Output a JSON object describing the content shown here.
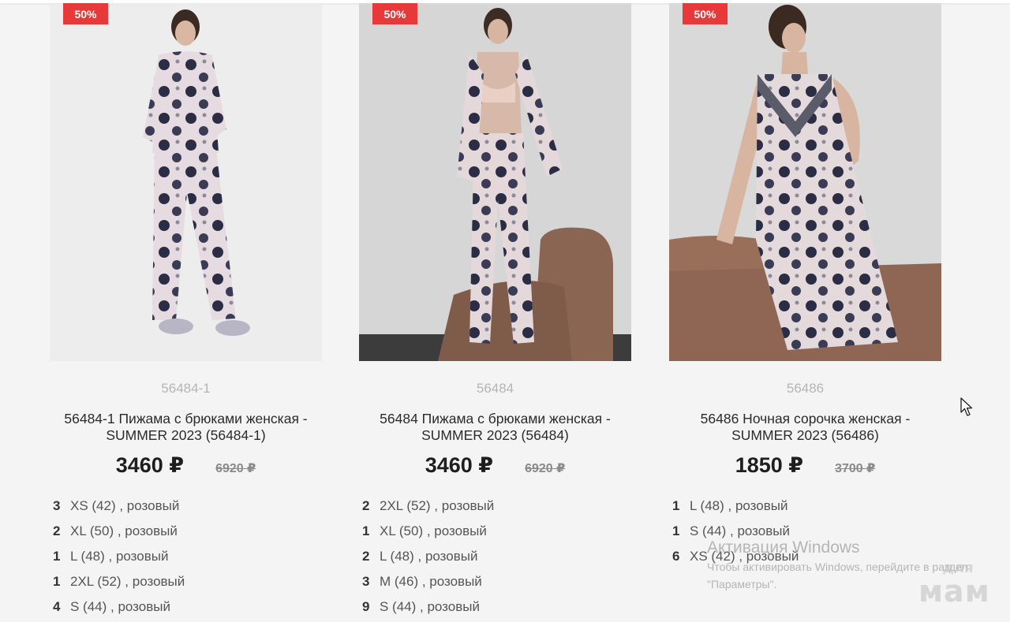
{
  "products": [
    {
      "badge": "50%",
      "sku": "56484-1",
      "name": "56484-1 Пижама с брюками женская - SUMMER 2023 (56484-1)",
      "price": "3460 ₽",
      "old_price": "6920 ₽",
      "sizes": [
        {
          "qty": "3",
          "label": "XS (42) , розовый"
        },
        {
          "qty": "2",
          "label": "XL (50) , розовый"
        },
        {
          "qty": "1",
          "label": "L (48) , розовый"
        },
        {
          "qty": "1",
          "label": "2XL (52) , розовый"
        },
        {
          "qty": "4",
          "label": "S (44) , розовый"
        }
      ]
    },
    {
      "badge": "50%",
      "sku": "56484",
      "name": "56484 Пижама с брюками женская - SUMMER 2023 (56484)",
      "price": "3460 ₽",
      "old_price": "6920 ₽",
      "sizes": [
        {
          "qty": "2",
          "label": "2XL (52) , розовый"
        },
        {
          "qty": "1",
          "label": "XL (50) , розовый"
        },
        {
          "qty": "2",
          "label": "L (48) , розовый"
        },
        {
          "qty": "3",
          "label": "M (46) , розовый"
        },
        {
          "qty": "9",
          "label": "S (44) , розовый"
        }
      ]
    },
    {
      "badge": "50%",
      "sku": "56486",
      "name": "56486 Ночная сорочка женская - SUMMER 2023 (56486)",
      "price": "1850 ₽",
      "old_price": "3700 ₽",
      "sizes": [
        {
          "qty": "1",
          "label": "L (48) , розовый"
        },
        {
          "qty": "1",
          "label": "S (44) , розовый"
        },
        {
          "qty": "6",
          "label": "XS (42) , розовый"
        }
      ]
    }
  ],
  "windows_watermark": {
    "title": "Активация Windows",
    "subtitle_line1": "Чтобы активировать Windows, перейдите в раздел",
    "subtitle_line2": "\"Параметры\"."
  },
  "brand_watermark": {
    "line1": "для",
    "line2": "мам"
  },
  "colors": {
    "badge": "#e8393a",
    "background": "#f4f4f4"
  }
}
